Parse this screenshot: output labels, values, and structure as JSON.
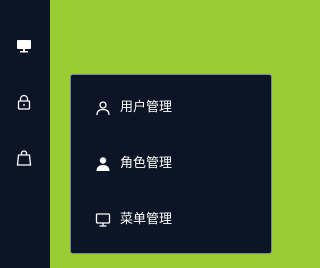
{
  "background_color": "#9ACD32",
  "sidebar": {
    "color": "#0b1526",
    "icons": [
      "monitor-icon",
      "lock-icon",
      "bag-icon"
    ]
  },
  "menu": {
    "items": [
      {
        "label": "用户管理",
        "icon": "user-outline-icon"
      },
      {
        "label": "角色管理",
        "icon": "user-filled-icon"
      },
      {
        "label": "菜单管理",
        "icon": "monitor-icon"
      }
    ]
  }
}
